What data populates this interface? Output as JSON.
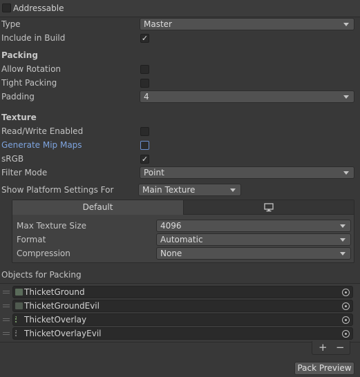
{
  "header": {
    "addressable_label": "Addressable",
    "addressable_checked": false
  },
  "general": {
    "type_label": "Type",
    "type_value": "Master",
    "include_label": "Include in Build",
    "include_checked": true
  },
  "packing": {
    "title": "Packing",
    "allow_rotation_label": "Allow Rotation",
    "tight_packing_label": "Tight Packing",
    "padding_label": "Padding",
    "padding_value": "4"
  },
  "texture": {
    "title": "Texture",
    "read_write_label": "Read/Write Enabled",
    "mip_maps_label": "Generate Mip Maps",
    "srgb_label": "sRGB",
    "srgb_checked": true,
    "filter_label": "Filter Mode",
    "filter_value": "Point"
  },
  "platform": {
    "show_for_label": "Show Platform Settings For",
    "show_for_value": "Main Texture",
    "tab_default": "Default",
    "tab_monitor_icon": "monitor-icon",
    "max_size_label": "Max Texture Size",
    "max_size_value": "4096",
    "format_label": "Format",
    "format_value": "Automatic",
    "compression_label": "Compression",
    "compression_value": "None"
  },
  "objects": {
    "title": "Objects for Packing",
    "items": [
      {
        "name": "ThicketGround"
      },
      {
        "name": "ThicketGroundEvil"
      },
      {
        "name": "ThicketOverlay"
      },
      {
        "name": "ThicketOverlayEvil"
      }
    ],
    "add_label": "+",
    "remove_label": "−"
  },
  "pack_preview_label": "Pack Preview"
}
